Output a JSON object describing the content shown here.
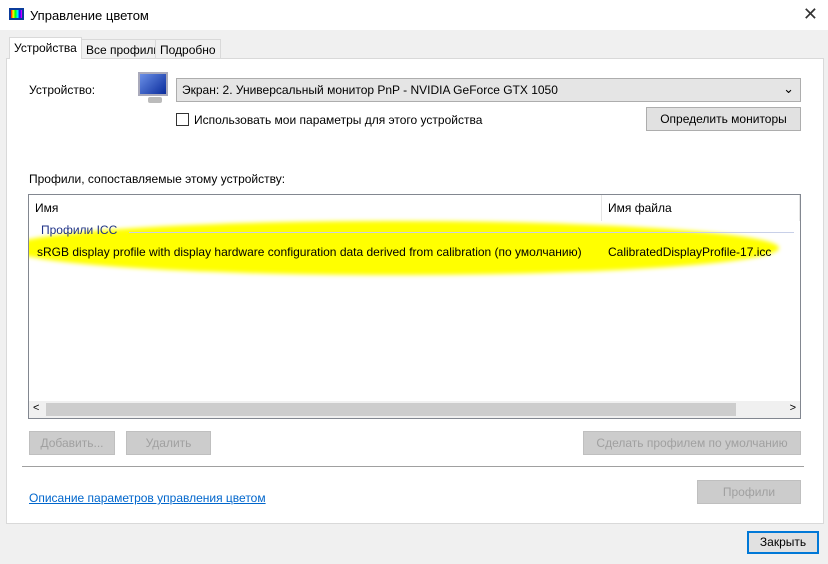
{
  "window": {
    "title": "Управление цветом",
    "close_icon": "close-icon"
  },
  "tabs": [
    {
      "label": "Устройства",
      "active": true
    },
    {
      "label": "Все профили"
    },
    {
      "label": "Подробно"
    }
  ],
  "device": {
    "label": "Устройство:",
    "selected": "Экран: 2. Универсальный монитор PnP - NVIDIA GeForce GTX 1050",
    "use_my_settings": "Использовать мои параметры для этого устройства",
    "use_my_settings_checked": false,
    "identify_button": "Определить мониторы"
  },
  "profiles": {
    "label": "Профили, сопоставляемые этому устройству:",
    "columns": [
      "Имя",
      "Имя файла"
    ],
    "group": "Профили ICC",
    "rows": [
      {
        "name": "sRGB display profile with display hardware configuration data derived from calibration (по умолчанию)",
        "file": "CalibratedDisplayProfile-17.icc"
      }
    ]
  },
  "buttons": {
    "add": "Добавить...",
    "remove": "Удалить",
    "set_default": "Сделать профилем по умолчанию",
    "profiles": "Профили",
    "close": "Закрыть"
  },
  "link": "Описание параметров управления цветом",
  "colors": {
    "highlight": "#ffff00",
    "link": "#0066cc",
    "focus": "#0078d7"
  }
}
